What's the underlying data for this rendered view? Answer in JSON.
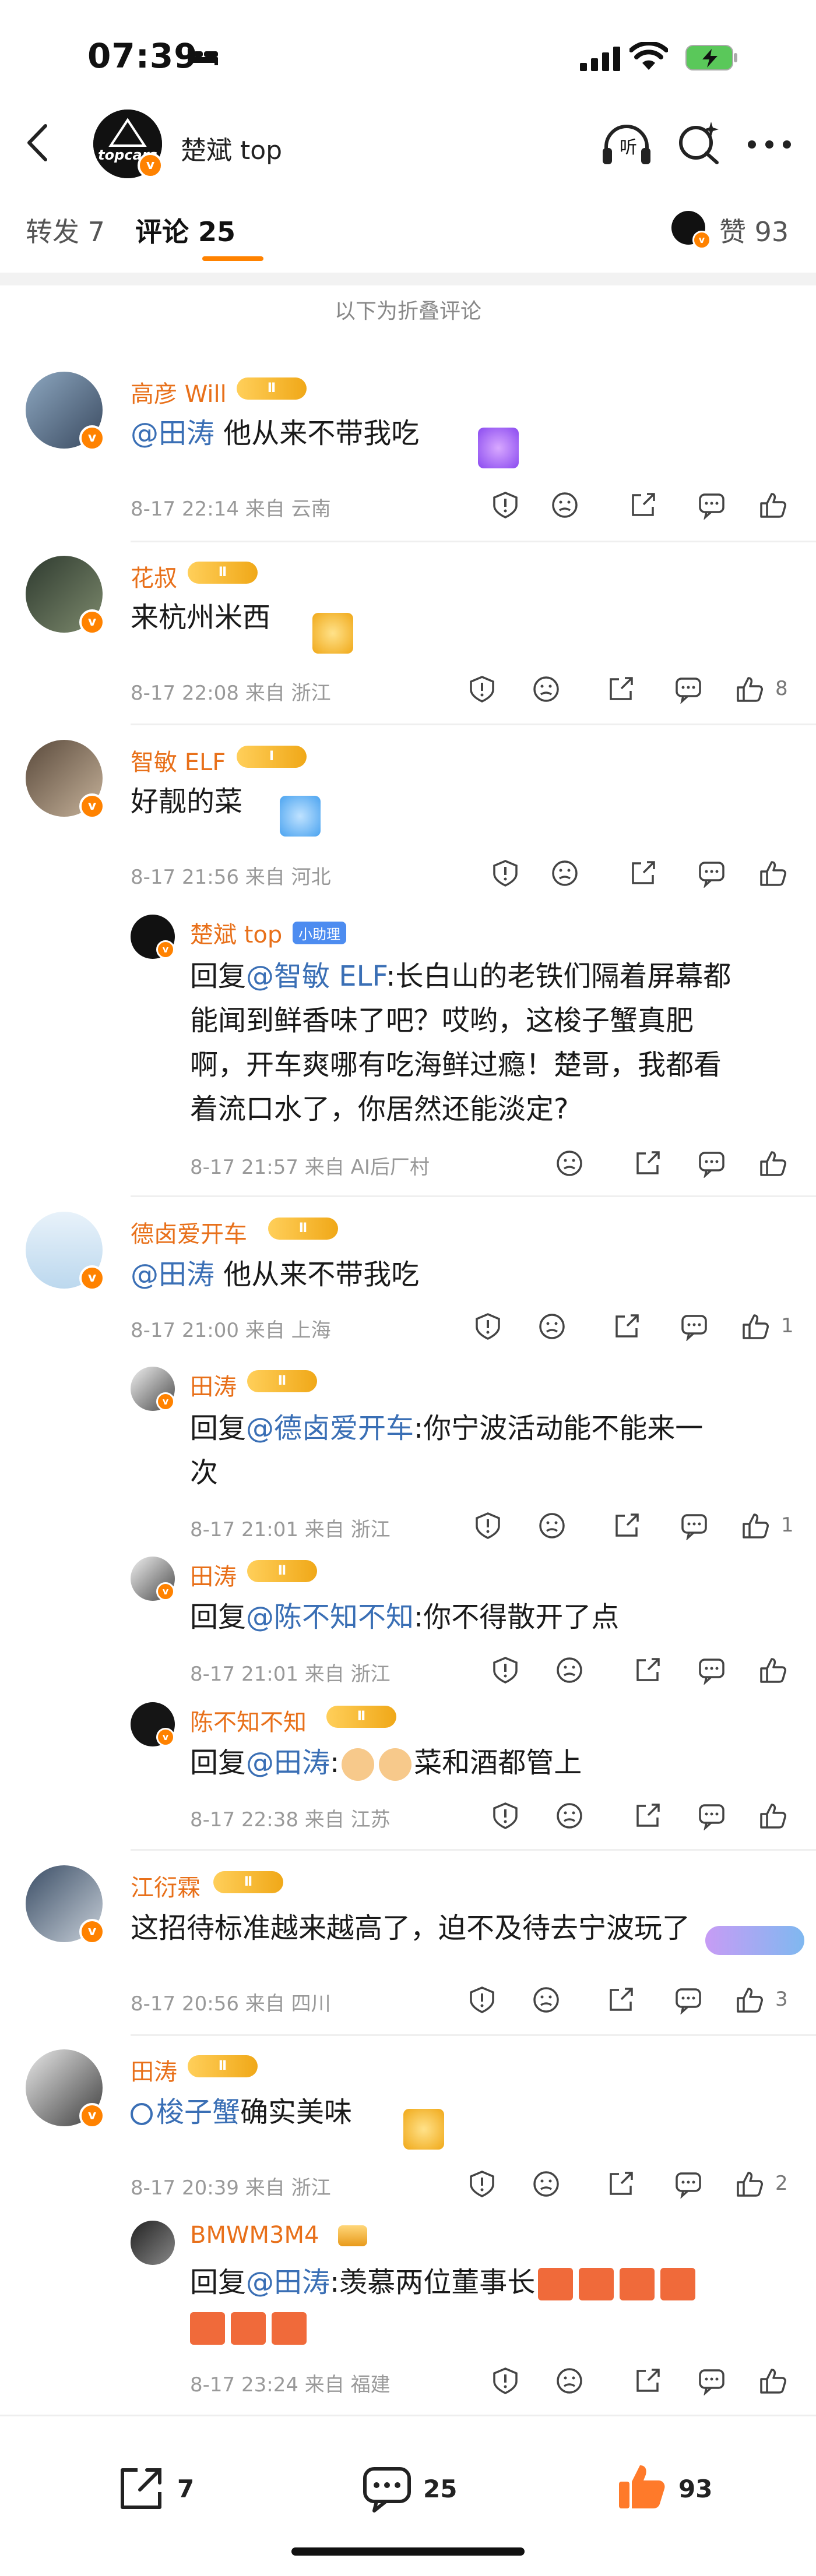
{
  "status_bar": {
    "time": "07:39"
  },
  "header": {
    "title": "楚斌 top",
    "listen_label": "听",
    "avatar_text": "topcars"
  },
  "tabs": {
    "repost": "转发 7",
    "comment": "评论 25",
    "like": "赞 93"
  },
  "fold_note": "以下为折叠评论",
  "comments": [
    {
      "name": "高彦 Will",
      "rank": "Ⅱ",
      "text_mention": "@田涛",
      "text": " 他从来不带我吃",
      "meta": "8-17 22:14  来自 云南",
      "likes": ""
    },
    {
      "name": "花叔",
      "rank": "Ⅱ",
      "text": "来杭州米西",
      "meta": "8-17 22:08  来自 浙江",
      "likes": "8"
    },
    {
      "name": "智敏 ELF",
      "rank": "Ⅰ",
      "text": "好靓的菜",
      "meta": "8-17 21:56  来自 河北",
      "likes": ""
    },
    {
      "name": "德卤爱开车",
      "rank": "Ⅱ",
      "text_mention": "@田涛",
      "text": " 他从来不带我吃",
      "meta": "8-17 21:00  来自 上海",
      "likes": "1"
    },
    {
      "name": "江衍霖",
      "rank": "Ⅱ",
      "text": "这招待标准越来越高了，迫不及待去宁波玩了",
      "meta": "8-17 20:56  来自 四川",
      "likes": "3"
    },
    {
      "name": "田涛",
      "rank": "Ⅱ",
      "text_mention": "梭子蟹",
      "text": "确实美味",
      "meta": "8-17 20:39  来自 浙江",
      "likes": "2"
    }
  ],
  "replies": {
    "r1": {
      "name": "楚斌 top",
      "badge": "小助理",
      "prefix": "回复",
      "mention": "@智敏 ELF",
      "text_lines": [
        ":长白山的老铁们隔着屏幕都",
        "能闻到鲜香味了吧？哎哟，这梭子蟹真肥",
        "啊，开车爽哪有吃海鲜过瘾！楚哥，我都看",
        "着流口水了，你居然还能淡定?"
      ],
      "meta": "8-17 21:57  来自 AI后厂村"
    },
    "r2": {
      "name": "田涛",
      "rank": "Ⅱ",
      "prefix": "回复",
      "mention": "@德卤爱开车",
      "text_lines": [
        ":你宁波活动能不能来一",
        "次"
      ],
      "meta": "8-17 21:01  来自 浙江",
      "likes": "1"
    },
    "r3": {
      "name": "田涛",
      "rank": "Ⅱ",
      "prefix": "回复",
      "mention": "@陈不知不知",
      "text": ":你不得散开了点",
      "meta": "8-17 21:01  来自 浙江"
    },
    "r4": {
      "name": "陈不知不知",
      "rank": "Ⅱ",
      "prefix": "回复",
      "mention": "@田涛",
      "text": ":",
      "text2": "菜和酒都管上",
      "meta": "8-17 22:38  来自 江苏"
    },
    "r5": {
      "name": "BMWM3M4",
      "prefix": "回复",
      "mention": "@田涛",
      "text": ":羡慕两位董事长",
      "meta": "8-17 23:24  来自 福建"
    }
  },
  "bottom_bar": {
    "repost": "7",
    "comment": "25",
    "like": "93"
  },
  "colors": {
    "accent": "#ff8200",
    "mention": "#3a6fb5",
    "username": "#e8701a"
  }
}
